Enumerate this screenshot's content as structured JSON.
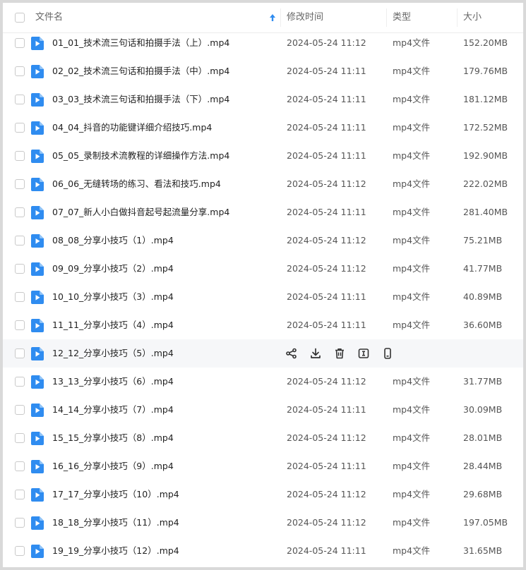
{
  "header": {
    "name_label": "文件名",
    "date_label": "修改时间",
    "type_label": "类型",
    "size_label": "大小",
    "sort_icon": "arrow-up-icon"
  },
  "colors": {
    "accent": "#2f8cf0",
    "hover_row": "#f6f7f9"
  },
  "files": [
    {
      "name": "01_01_技术流三句话和拍摄手法（上）.mp4",
      "date": "2024-05-24 11:12",
      "type": "mp4文件",
      "size": "152.20MB"
    },
    {
      "name": "02_02_技术流三句话和拍摄手法（中）.mp4",
      "date": "2024-05-24 11:11",
      "type": "mp4文件",
      "size": "179.76MB"
    },
    {
      "name": "03_03_技术流三句话和拍摄手法（下）.mp4",
      "date": "2024-05-24 11:11",
      "type": "mp4文件",
      "size": "181.12MB"
    },
    {
      "name": "04_04_抖音的功能键详细介绍技巧.mp4",
      "date": "2024-05-24 11:11",
      "type": "mp4文件",
      "size": "172.52MB"
    },
    {
      "name": "05_05_录制技术流教程的详细操作方法.mp4",
      "date": "2024-05-24 11:11",
      "type": "mp4文件",
      "size": "192.90MB"
    },
    {
      "name": "06_06_无缝转场的练习、看法和技巧.mp4",
      "date": "2024-05-24 11:12",
      "type": "mp4文件",
      "size": "222.02MB"
    },
    {
      "name": "07_07_新人小白做抖音起号起流量分享.mp4",
      "date": "2024-05-24 11:11",
      "type": "mp4文件",
      "size": "281.40MB"
    },
    {
      "name": "08_08_分享小技巧（1）.mp4",
      "date": "2024-05-24 11:12",
      "type": "mp4文件",
      "size": "75.21MB"
    },
    {
      "name": "09_09_分享小技巧（2）.mp4",
      "date": "2024-05-24 11:12",
      "type": "mp4文件",
      "size": "41.77MB"
    },
    {
      "name": "10_10_分享小技巧（3）.mp4",
      "date": "2024-05-24 11:11",
      "type": "mp4文件",
      "size": "40.89MB"
    },
    {
      "name": "11_11_分享小技巧（4）.mp4",
      "date": "2024-05-24 11:11",
      "type": "mp4文件",
      "size": "36.60MB"
    },
    {
      "name": "12_12_分享小技巧（5）.mp4",
      "date": "",
      "type": "",
      "size": "",
      "hover": true
    },
    {
      "name": "13_13_分享小技巧（6）.mp4",
      "date": "2024-05-24 11:12",
      "type": "mp4文件",
      "size": "31.77MB"
    },
    {
      "name": "14_14_分享小技巧（7）.mp4",
      "date": "2024-05-24 11:11",
      "type": "mp4文件",
      "size": "30.09MB"
    },
    {
      "name": "15_15_分享小技巧（8）.mp4",
      "date": "2024-05-24 11:12",
      "type": "mp4文件",
      "size": "28.01MB"
    },
    {
      "name": "16_16_分享小技巧（9）.mp4",
      "date": "2024-05-24 11:11",
      "type": "mp4文件",
      "size": "28.44MB"
    },
    {
      "name": "17_17_分享小技巧（10）.mp4",
      "date": "2024-05-24 11:12",
      "type": "mp4文件",
      "size": "29.68MB"
    },
    {
      "name": "18_18_分享小技巧（11）.mp4",
      "date": "2024-05-24 11:12",
      "type": "mp4文件",
      "size": "197.05MB"
    },
    {
      "name": "19_19_分享小技巧（12）.mp4",
      "date": "2024-05-24 11:11",
      "type": "mp4文件",
      "size": "31.65MB"
    }
  ],
  "hover_actions": [
    "share-icon",
    "download-icon",
    "delete-icon",
    "rename-icon",
    "phone-icon"
  ]
}
